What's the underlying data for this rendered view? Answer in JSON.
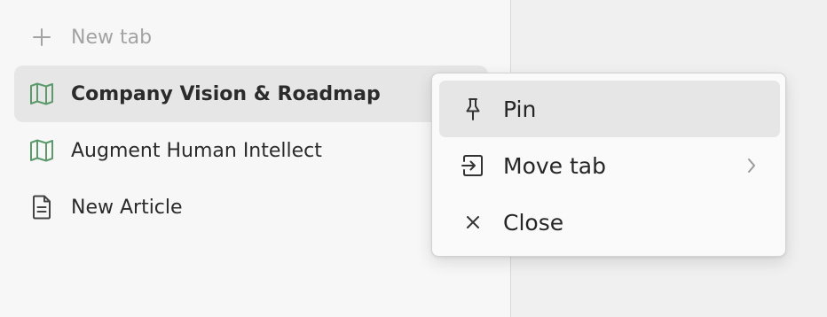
{
  "sidebar": {
    "new_tab_label": "New tab",
    "tabs": [
      {
        "label": "Company Vision & Roadmap",
        "icon": "map-icon",
        "active": true
      },
      {
        "label": "Augment Human Intellect",
        "icon": "map-icon",
        "active": false
      },
      {
        "label": "New Article",
        "icon": "document-icon",
        "active": false
      }
    ]
  },
  "context_menu": {
    "items": [
      {
        "label": "Pin",
        "icon": "pin-icon",
        "hovered": true
      },
      {
        "label": "Move tab",
        "icon": "move-to-icon",
        "submenu": true
      },
      {
        "label": "Close",
        "icon": "close-icon"
      }
    ]
  },
  "colors": {
    "map_icon": "#5b9a6a",
    "muted_text": "#a3a3a3",
    "text": "#2b2b2b",
    "active_bg": "#e6e6e6"
  }
}
